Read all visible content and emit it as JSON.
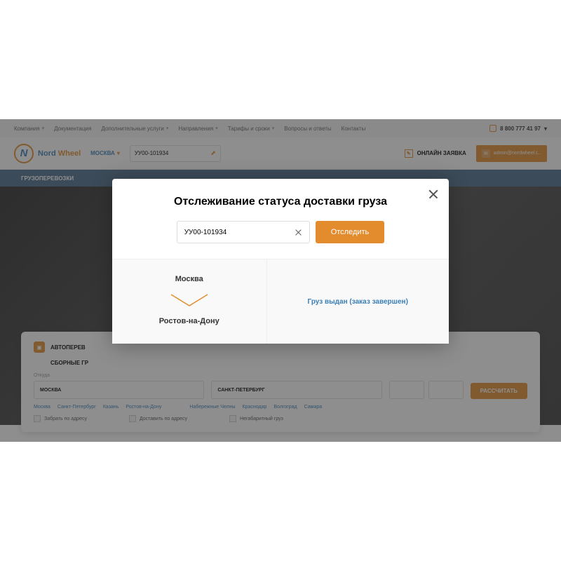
{
  "topnav": {
    "items": [
      "Компания",
      "Документация",
      "Дополнительные услуги",
      "Направления",
      "Тарифы и сроки",
      "Вопросы и ответы",
      "Контакты"
    ],
    "dropdowns": [
      true,
      false,
      true,
      true,
      true,
      false,
      false
    ],
    "phone": "8 800 777 41 97"
  },
  "header": {
    "brand_nord": "Nord",
    "brand_wheel": " Wheel",
    "city": "МОСКВА",
    "track_value": "УУ00-101934",
    "order_label": "ОНЛАЙН ЗАЯВКА",
    "email": "admin@nordwheel.t..."
  },
  "navbar": {
    "item": "ГРУЗОПЕРЕВОЗКИ"
  },
  "calc": {
    "title": "АВТОПЕРЕВ",
    "tab": "СБОРНЫЕ ГР",
    "from_label": "Откуда",
    "from_value": "МОСКВА",
    "to_value": "САНКТ-ПЕТЕРБУРГ",
    "btn": "РАССЧИТАТЬ",
    "cities_from": [
      "Москва",
      "Санкт-Петербург",
      "Казань",
      "Ростов-на-Дону"
    ],
    "cities_to": [
      "Набережные Челны",
      "Краснодар",
      "Волгоград",
      "Самара"
    ],
    "check1": "Забрать по адресу",
    "check2": "Доставить по адресу",
    "check3": "Негабаритный груз"
  },
  "modal": {
    "title": "Отслеживание статуса доставки груза",
    "input_value": "УУ00-101934",
    "track_btn": "Отследить",
    "from_city": "Москва",
    "to_city": "Ростов-на-Дону",
    "status": "Груз выдан (заказ завершен)"
  }
}
